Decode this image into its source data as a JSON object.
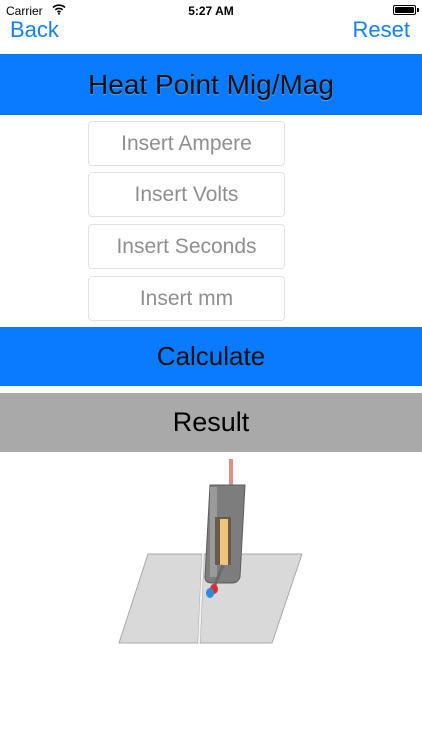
{
  "status_bar": {
    "carrier": "Carrier",
    "time": "5:27 AM",
    "icons": [
      "wifi-icon",
      "battery-icon"
    ]
  },
  "nav": {
    "back_label": "Back",
    "reset_label": "Reset",
    "accent_color": "#157efb"
  },
  "header": {
    "title": "Heat Point Mig/Mag",
    "background": "#0a7bff"
  },
  "form": {
    "ampere_placeholder": "Insert Ampere",
    "volts_placeholder": "Insert Volts",
    "seconds_placeholder": "Insert Seconds",
    "mm_placeholder": "Insert mm",
    "ampere_value": "",
    "volts_value": "",
    "seconds_value": "",
    "mm_value": ""
  },
  "actions": {
    "calculate_label": "Calculate"
  },
  "result": {
    "label": "Result",
    "background": "#a9a9a9"
  },
  "illustration": {
    "icon": "mig-welding-torch-illustration"
  }
}
